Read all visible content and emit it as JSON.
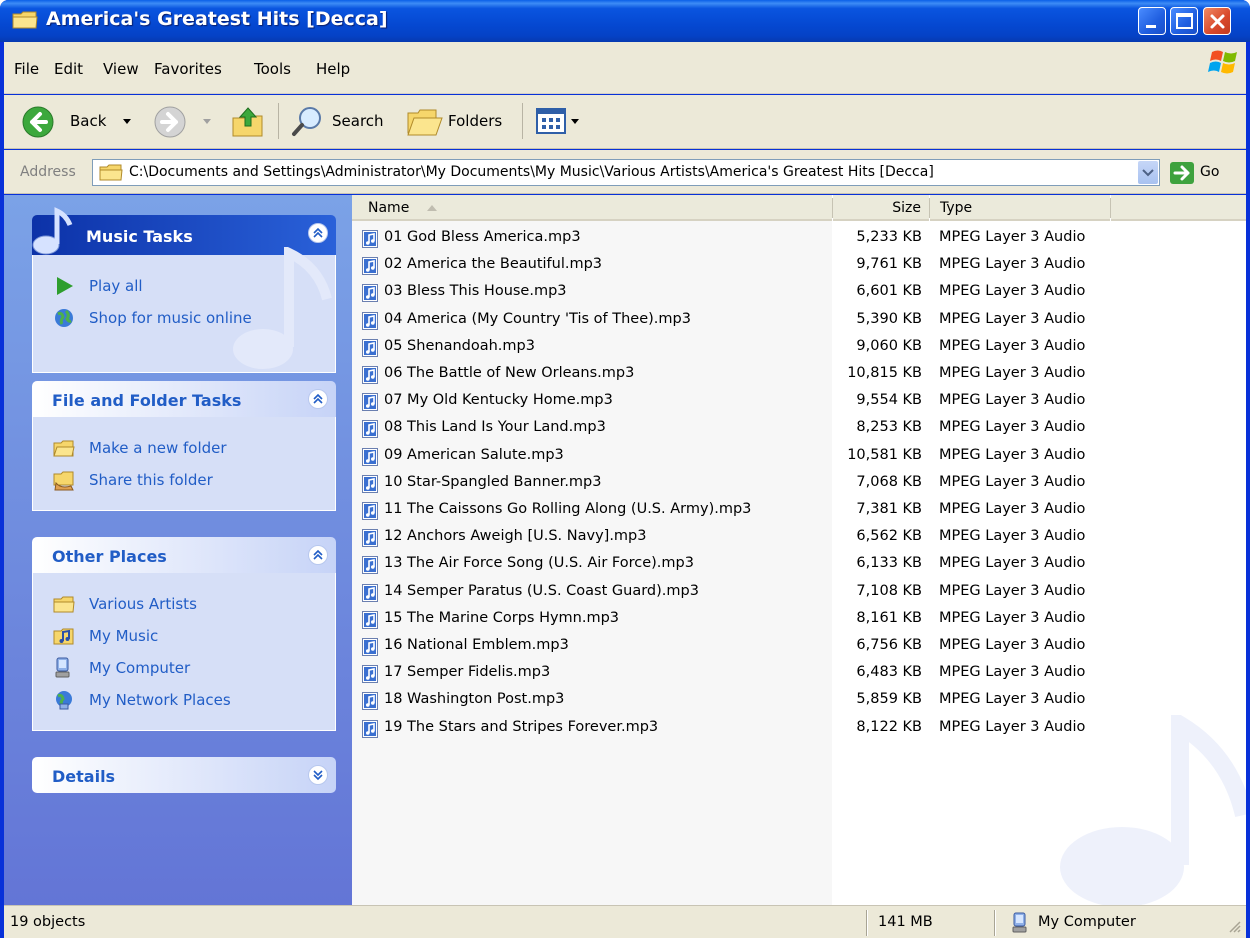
{
  "window": {
    "title": "America's Greatest Hits [Decca]"
  },
  "menu": {
    "items": [
      "File",
      "Edit",
      "View",
      "Favorites",
      "Tools",
      "Help"
    ]
  },
  "toolbar": {
    "back_label": "Back",
    "search_label": "Search",
    "folders_label": "Folders"
  },
  "address": {
    "label": "Address",
    "path": "C:\\Documents and Settings\\Administrator\\My Documents\\My Music\\Various Artists\\America's Greatest Hits [Decca]",
    "go_label": "Go"
  },
  "taskpane": {
    "music_tasks": {
      "title": "Music Tasks",
      "items": [
        "Play all",
        "Shop for music online"
      ]
    },
    "file_folder_tasks": {
      "title": "File and Folder Tasks",
      "items": [
        "Make a new folder",
        "Share this folder"
      ]
    },
    "other_places": {
      "title": "Other Places",
      "items": [
        "Various Artists",
        "My Music",
        "My Computer",
        "My Network Places"
      ]
    },
    "details": {
      "title": "Details"
    }
  },
  "filelist": {
    "columns": [
      "Name",
      "Size",
      "Type"
    ],
    "files": [
      {
        "name": "01 God Bless America.mp3",
        "size": "5,233 KB",
        "type": "MPEG Layer 3 Audio"
      },
      {
        "name": "02 America the Beautiful.mp3",
        "size": "9,761 KB",
        "type": "MPEG Layer 3 Audio"
      },
      {
        "name": "03 Bless This House.mp3",
        "size": "6,601 KB",
        "type": "MPEG Layer 3 Audio"
      },
      {
        "name": "04 America (My Country 'Tis of Thee).mp3",
        "size": "5,390 KB",
        "type": "MPEG Layer 3 Audio"
      },
      {
        "name": "05 Shenandoah.mp3",
        "size": "9,060 KB",
        "type": "MPEG Layer 3 Audio"
      },
      {
        "name": "06 The Battle of New Orleans.mp3",
        "size": "10,815 KB",
        "type": "MPEG Layer 3 Audio"
      },
      {
        "name": "07 My Old Kentucky Home.mp3",
        "size": "9,554 KB",
        "type": "MPEG Layer 3 Audio"
      },
      {
        "name": "08 This Land Is Your Land.mp3",
        "size": "8,253 KB",
        "type": "MPEG Layer 3 Audio"
      },
      {
        "name": "09 American Salute.mp3",
        "size": "10,581 KB",
        "type": "MPEG Layer 3 Audio"
      },
      {
        "name": "10 Star-Spangled Banner.mp3",
        "size": "7,068 KB",
        "type": "MPEG Layer 3 Audio"
      },
      {
        "name": "11 The Caissons Go Rolling Along (U.S. Army).mp3",
        "size": "7,381 KB",
        "type": "MPEG Layer 3 Audio"
      },
      {
        "name": "12 Anchors Aweigh [U.S. Navy].mp3",
        "size": "6,562 KB",
        "type": "MPEG Layer 3 Audio"
      },
      {
        "name": "13 The Air Force Song (U.S. Air Force).mp3",
        "size": "6,133 KB",
        "type": "MPEG Layer 3 Audio"
      },
      {
        "name": "14 Semper Paratus (U.S. Coast Guard).mp3",
        "size": "7,108 KB",
        "type": "MPEG Layer 3 Audio"
      },
      {
        "name": "15 The Marine Corps Hymn.mp3",
        "size": "8,161 KB",
        "type": "MPEG Layer 3 Audio"
      },
      {
        "name": "16 National Emblem.mp3",
        "size": "6,756 KB",
        "type": "MPEG Layer 3 Audio"
      },
      {
        "name": "17 Semper Fidelis.mp3",
        "size": "6,483 KB",
        "type": "MPEG Layer 3 Audio"
      },
      {
        "name": "18 Washington Post.mp3",
        "size": "5,859 KB",
        "type": "MPEG Layer 3 Audio"
      },
      {
        "name": "19 The Stars and Stripes Forever.mp3",
        "size": "8,122 KB",
        "type": "MPEG Layer 3 Audio"
      }
    ]
  },
  "status": {
    "objects": "19 objects",
    "total_size": "141 MB",
    "location": "My Computer"
  }
}
